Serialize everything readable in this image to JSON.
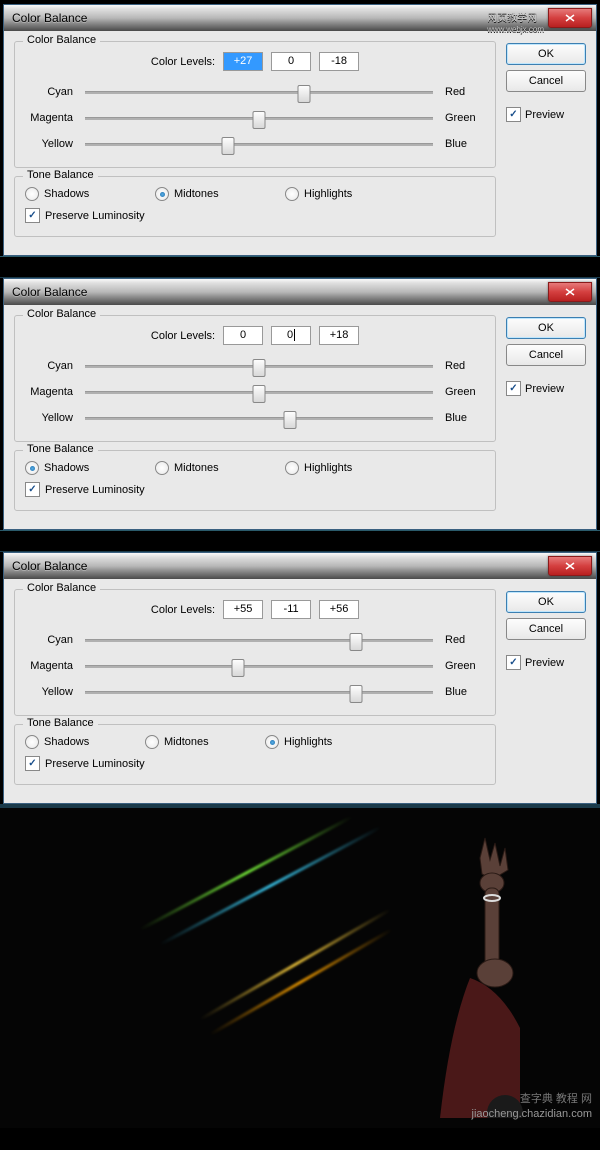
{
  "dialogs": [
    {
      "title": "Color Balance",
      "watermark": "网页教学网",
      "watermark2": "www.webjx.com",
      "cb_legend": "Color Balance",
      "levels_label": "Color Levels:",
      "levels": [
        "+27",
        "0",
        "-18"
      ],
      "level_selected": 0,
      "sliders": [
        {
          "l": "Cyan",
          "r": "Red",
          "pos": 63
        },
        {
          "l": "Magenta",
          "r": "Green",
          "pos": 50
        },
        {
          "l": "Yellow",
          "r": "Blue",
          "pos": 41
        }
      ],
      "tb_legend": "Tone Balance",
      "tones": [
        {
          "label": "Shadows",
          "on": false
        },
        {
          "label": "Midtones",
          "on": true
        },
        {
          "label": "Highlights",
          "on": false
        }
      ],
      "preserve": "Preserve Luminosity"
    },
    {
      "title": "Color Balance",
      "cb_legend": "Color Balance",
      "levels_label": "Color Levels:",
      "levels": [
        "0",
        "0",
        "+18"
      ],
      "level_selected": -1,
      "cursor_field": 1,
      "sliders": [
        {
          "l": "Cyan",
          "r": "Red",
          "pos": 50
        },
        {
          "l": "Magenta",
          "r": "Green",
          "pos": 50
        },
        {
          "l": "Yellow",
          "r": "Blue",
          "pos": 59
        }
      ],
      "tb_legend": "Tone Balance",
      "tones": [
        {
          "label": "Shadows",
          "on": true
        },
        {
          "label": "Midtones",
          "on": false
        },
        {
          "label": "Highlights",
          "on": false
        }
      ],
      "preserve": "Preserve Luminosity"
    },
    {
      "title": "Color Balance",
      "cb_legend": "Color Balance",
      "levels_label": "Color Levels:",
      "levels": [
        "+55",
        "-11",
        "+56"
      ],
      "level_selected": -1,
      "sliders": [
        {
          "l": "Cyan",
          "r": "Red",
          "pos": 78
        },
        {
          "l": "Magenta",
          "r": "Green",
          "pos": 44
        },
        {
          "l": "Yellow",
          "r": "Blue",
          "pos": 78
        }
      ],
      "tb_legend": "Tone Balance",
      "tones": [
        {
          "label": "Shadows",
          "on": false
        },
        {
          "label": "Midtones",
          "on": false
        },
        {
          "label": "Highlights",
          "on": true
        }
      ],
      "preserve": "Preserve Luminosity"
    }
  ],
  "buttons": {
    "ok": "OK",
    "cancel": "Cancel",
    "preview": "Preview"
  },
  "bottom_watermark1": "查字典 教程 网",
  "bottom_watermark2": "jiaocheng.chazidian.com"
}
